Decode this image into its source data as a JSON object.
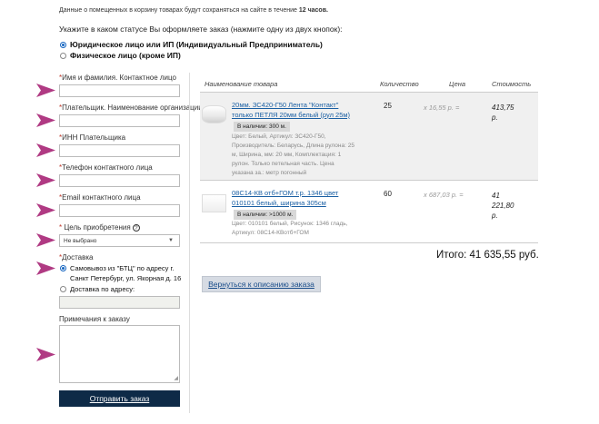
{
  "notice": {
    "text": "Данные о помещенных в корзину товарах будут сохраняться на сайте в течение ",
    "bold": "12 часов."
  },
  "status": {
    "question": "Укажите в каком статусе Вы оформляете заказ (нажмите одну из двух кнопок):",
    "options": [
      {
        "label": "Юридическое лицо или ИП (Индивидуальный Предприниматель)",
        "selected": true
      },
      {
        "label": "Физическое лицо (кроме ИП)",
        "selected": false
      }
    ]
  },
  "form": {
    "fields": [
      {
        "required": "*",
        "label": "Имя и фамилия. Контактное лицо",
        "value": ""
      },
      {
        "required": "*",
        "label": "Плательщик. Наименование организации",
        "value": ""
      },
      {
        "required": "*",
        "label": "ИНН Плательщика",
        "value": ""
      },
      {
        "required": "*",
        "label": "Телефон контактного лица",
        "value": ""
      },
      {
        "required": "*",
        "label": "Email контактного лица",
        "value": ""
      }
    ],
    "purpose": {
      "required": "*",
      "label": "Цель приобретения",
      "help": "?",
      "selected": "Не выбрано"
    },
    "delivery": {
      "required": "*",
      "label": "Доставка",
      "options": [
        {
          "label": "Самовывоз из \"БТЦ\" по адресу г. Санкт Петербург, ул. Якорная д. 16",
          "selected": true
        },
        {
          "label": "Доставка по адресу:",
          "selected": false
        }
      ]
    },
    "notes_label": "Примечания к заказу",
    "submit_label": "Отправить заказ"
  },
  "cart": {
    "headers": {
      "name": "Наименование товара",
      "qty": "Количество",
      "price": "Цена",
      "cost": "Стоимость"
    },
    "items": [
      {
        "title": "20мм. ЗС420-Г50 Лента \"Контакт\" только ПЕТЛЯ 20мм белый (рул 25м)",
        "stock": "В наличии: 300 м.",
        "desc": "Цвет: Белый, Артикул: ЗС420-Г50, Производитель: Беларусь, Длина рулона: 25 м, Ширина, мм: 20 мм, Комплектация: 1 рулон. Только петельная часть. Цена указана за.: метр погонный",
        "qty": "25",
        "price": "х   16,55 р.   =",
        "cost": [
          "413,75",
          "р."
        ]
      },
      {
        "title": "08С14-КВ отб+ГОМ т.р. 1346 цвет 010101 белый, ширина 305см",
        "stock": "В наличии: >1000 м.",
        "desc": "Цвет: 010101 белый, Рисунок: 1346 гладь, Артикул: 08С14-КВотб+ГОМ",
        "qty": "60",
        "price": "х   687,03 р.   =",
        "cost": [
          "41",
          "221,80",
          "р."
        ]
      }
    ],
    "total": "Итого: 41 635,55 руб.",
    "back_label": "Вернуться к описанию заказа"
  },
  "colors": {
    "arrow": "#b03a83",
    "submit": "#0e2a47",
    "link": "#1a5fa3"
  }
}
